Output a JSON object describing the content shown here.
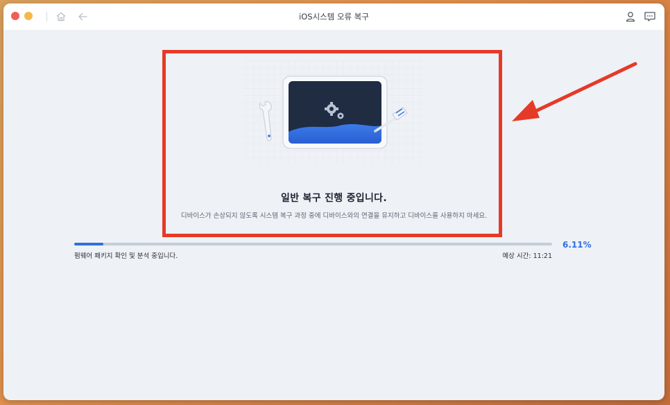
{
  "window": {
    "title": "iOS시스템 오류 복구"
  },
  "icons": {
    "home": "home-icon",
    "back": "back-arrow-icon",
    "user": "user-icon",
    "feedback": "chat-icon"
  },
  "main": {
    "heading": "일반 복구 진행 중입니다.",
    "description": "디바이스가 손상되지 않도록 시스템 복구 과정 중에 디바이스와의 연결을 유지하고 디바이스를 사용하지 마세요."
  },
  "progress": {
    "value": 0.0611,
    "percent_label": "6.11%",
    "status_text": "펌웨어 패키지 확인 및 분석 중입니다.",
    "estimated_time": "예상 시간: 11:21"
  },
  "colors": {
    "accent": "#2f6fe0",
    "highlight": "#e53a27"
  }
}
